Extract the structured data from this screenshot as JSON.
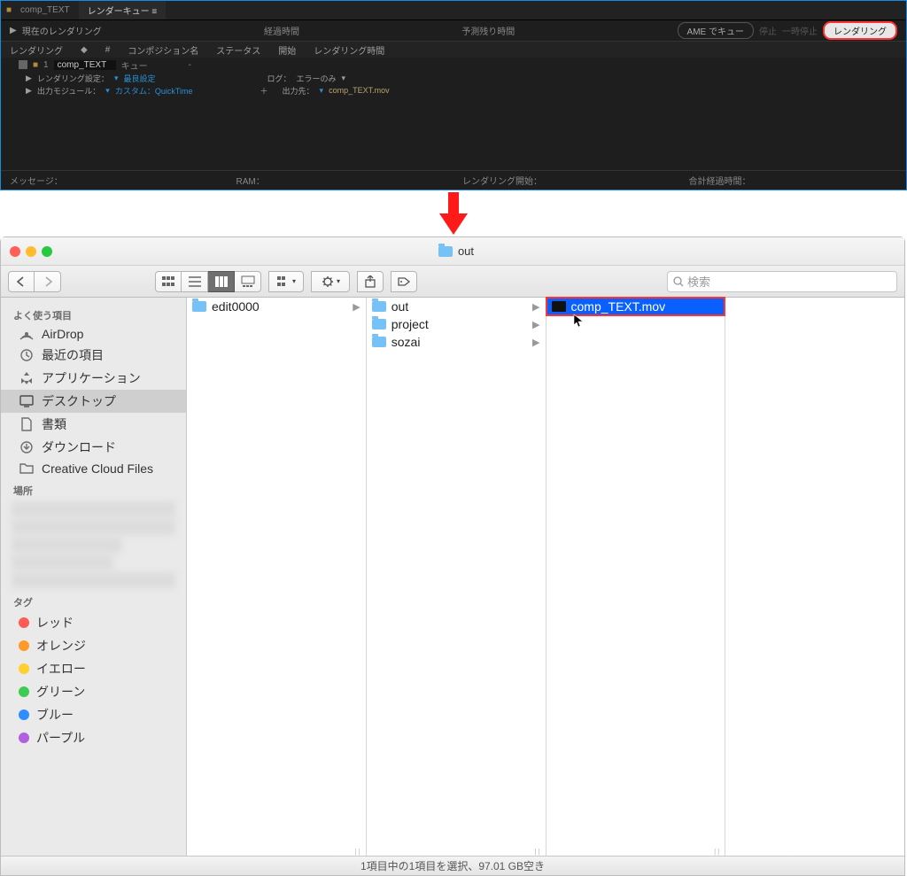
{
  "ae": {
    "tabs": {
      "comp": "comp_TEXT",
      "queue": "レンダーキュー ≡"
    },
    "current_label": "現在のレンダリング",
    "elapsed_label": "経過時間",
    "remain_label": "予測残り時間",
    "ame_btn": "AME でキュー",
    "stop_btn": "停止",
    "pause_btn": "一時停止",
    "render_btn": "レンダリング",
    "headers": {
      "render": "レンダリング",
      "num": "#",
      "comp": "コンポジション名",
      "status": "ステータス",
      "start": "開始",
      "time": "レンダリング時間"
    },
    "row": {
      "num": "1",
      "name": "comp_TEXT",
      "status": "キュー",
      "dash": "-"
    },
    "sub1_label": "レンダリング設定：",
    "sub1_link": "最良設定",
    "sub1_log": "ログ：",
    "sub1_log_val": "エラーのみ",
    "sub2_label": "出力モジュール：",
    "sub2_link": "カスタム：QuickTime",
    "sub2_plus": "＋",
    "sub2_out": "出力先：",
    "sub2_file": "comp_TEXT.mov",
    "footer": {
      "msg": "メッセージ：",
      "ram": "RAM：",
      "start": "レンダリング開始：",
      "total": "合計経過時間："
    }
  },
  "finder": {
    "title": "out",
    "search_placeholder": "検索",
    "sidebar": {
      "favorites": "よく使う項目",
      "items": [
        "AirDrop",
        "最近の項目",
        "アプリケーション",
        "デスクトップ",
        "書類",
        "ダウンロード",
        "Creative Cloud Files"
      ],
      "locations": "場所",
      "tags_label": "タグ",
      "tags": [
        {
          "label": "レッド",
          "color": "#ff5b55"
        },
        {
          "label": "オレンジ",
          "color": "#ff9a29"
        },
        {
          "label": "イエロー",
          "color": "#ffd02e"
        },
        {
          "label": "グリーン",
          "color": "#3ecb52"
        },
        {
          "label": "ブルー",
          "color": "#2e8dff"
        },
        {
          "label": "パープル",
          "color": "#b25fe0"
        }
      ]
    },
    "col1": [
      {
        "label": "edit0000"
      }
    ],
    "col2": [
      {
        "label": "out"
      },
      {
        "label": "project"
      },
      {
        "label": "sozai"
      }
    ],
    "col3": [
      {
        "label": "comp_TEXT.mov"
      }
    ],
    "status": "1項目中の1項目を選択、97.01 GB空き"
  }
}
